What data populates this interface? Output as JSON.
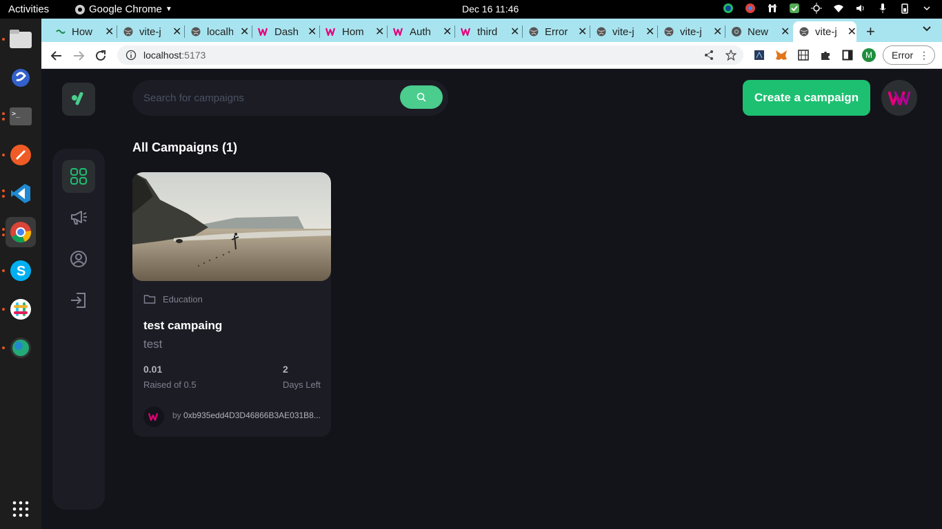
{
  "system": {
    "activities": "Activities",
    "app_name": "Google Chrome",
    "clock": "Dec 16  11:46"
  },
  "tabs": [
    {
      "title": "How",
      "icon": "link-icon"
    },
    {
      "title": "vite-j",
      "icon": "globe-icon"
    },
    {
      "title": "localh",
      "icon": "globe-icon"
    },
    {
      "title": "Dash",
      "icon": "w-logo-icon"
    },
    {
      "title": "Hom",
      "icon": "w-logo-icon"
    },
    {
      "title": "Auth",
      "icon": "w-logo-icon"
    },
    {
      "title": "third",
      "icon": "w-logo-icon"
    },
    {
      "title": "Error",
      "icon": "globe-icon"
    },
    {
      "title": "vite-j",
      "icon": "globe-icon"
    },
    {
      "title": "vite-j",
      "icon": "globe-icon"
    },
    {
      "title": "New",
      "icon": "chrome-icon"
    },
    {
      "title": "vite-j",
      "icon": "globe-icon"
    }
  ],
  "address": {
    "host": "localhost",
    "port": ":5173"
  },
  "profile": {
    "initial": "M",
    "status": "Error"
  },
  "search": {
    "placeholder": "Search for campaigns"
  },
  "header": {
    "create_label": "Create a campaign"
  },
  "section": {
    "title": "All Campaigns (1)"
  },
  "campaign": {
    "category": "Education",
    "title": "test campaing",
    "description": "test",
    "raised": "0.01",
    "raised_label": "Raised of 0.5",
    "days": "2",
    "days_label": "Days Left",
    "owner_prefix": "by ",
    "owner": "0xb935edd4D3D46866B3AE031B8..."
  },
  "colors": {
    "accent": "#1dc071",
    "brand": "#4acd8d",
    "logo_pink": "#e6007a"
  }
}
